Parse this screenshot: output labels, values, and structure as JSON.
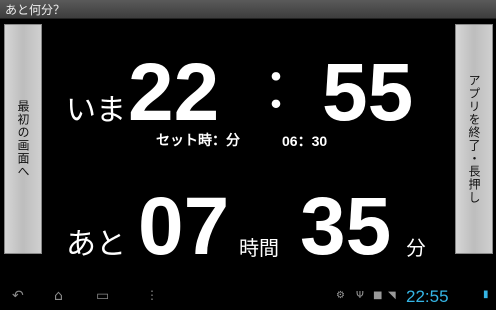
{
  "app": {
    "title": "あと何分？"
  },
  "buttons": {
    "left_label": "最初の画面へ",
    "right_label": "アプリを終了・長押し"
  },
  "now": {
    "prefix": "いま",
    "hour": "22",
    "sep": "：",
    "minute": "55"
  },
  "set": {
    "label": "セット時：分",
    "time": "06：30"
  },
  "remaining": {
    "prefix": "あと",
    "hours": "07",
    "hours_unit": "時間",
    "minutes": "35",
    "minutes_unit": "分"
  },
  "status": {
    "clock": "22:55",
    "accent": "#35b5e5"
  },
  "icons": [
    "back-icon",
    "home-icon",
    "recent-apps-icon",
    "menu-icon",
    "android-icon",
    "usb-icon",
    "sd-card-icon",
    "wifi-icon",
    "battery-icon"
  ]
}
